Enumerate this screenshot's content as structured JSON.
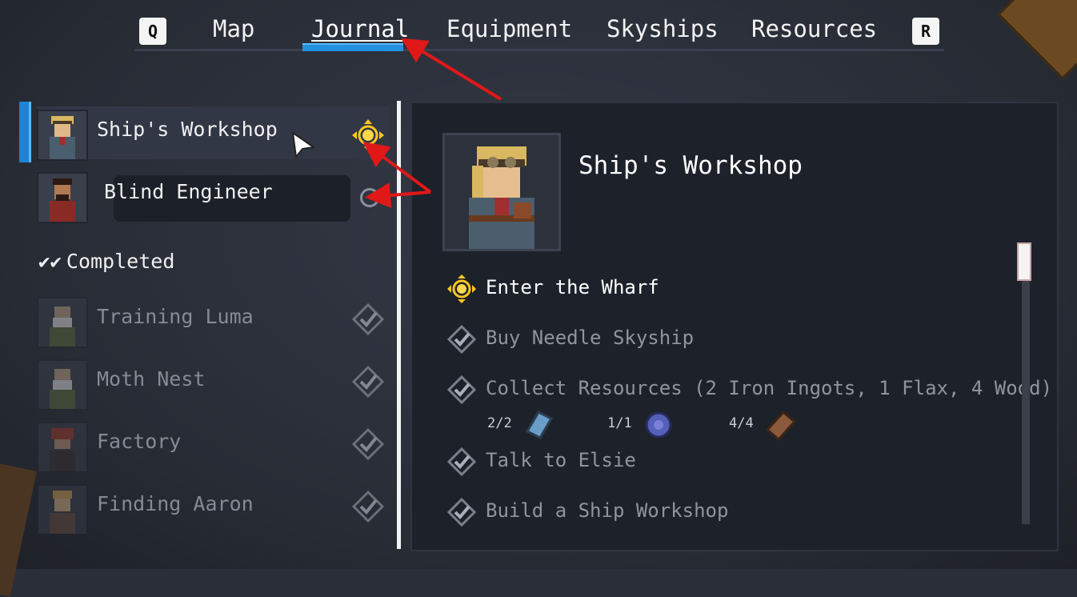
{
  "tabs": {
    "left_key": "Q",
    "right_key": "R",
    "items": [
      {
        "label": "Map"
      },
      {
        "label": "Journal",
        "active": true
      },
      {
        "label": "Equipment"
      },
      {
        "label": "Skyships"
      },
      {
        "label": "Resources"
      }
    ]
  },
  "quests": {
    "active": [
      {
        "name": "Ship's Workshop",
        "selected": true,
        "state": "tracked"
      },
      {
        "name": "Blind Engineer",
        "state": "untracked"
      }
    ],
    "completed_label": "Completed",
    "completed": [
      {
        "name": "Training Luma"
      },
      {
        "name": "Moth Nest"
      },
      {
        "name": "Factory"
      },
      {
        "name": "Finding Aaron"
      }
    ]
  },
  "detail": {
    "title": "Ship's Workshop",
    "objectives": [
      {
        "text": "Enter the Wharf",
        "state": "active"
      },
      {
        "text": "Buy Needle Skyship",
        "state": "done"
      },
      {
        "text": "Collect Resources (2 Iron Ingots, 1 Flax, 4 Wood)",
        "state": "done"
      },
      {
        "text": "Talk to Elsie",
        "state": "done"
      },
      {
        "text": "Build a Ship Workshop",
        "state": "done"
      }
    ],
    "resources": [
      {
        "count": "2/2",
        "icon": "iron-ingot-icon",
        "color": "#6a9ec8"
      },
      {
        "count": "1/1",
        "icon": "flax-icon",
        "color": "#5560b8"
      },
      {
        "count": "4/4",
        "icon": "wood-icon",
        "color": "#8a5a3c"
      }
    ]
  },
  "colors": {
    "accent_blue": "#1d83d6",
    "track_yellow": "#ffc81e",
    "annotation_red": "#e01818"
  }
}
